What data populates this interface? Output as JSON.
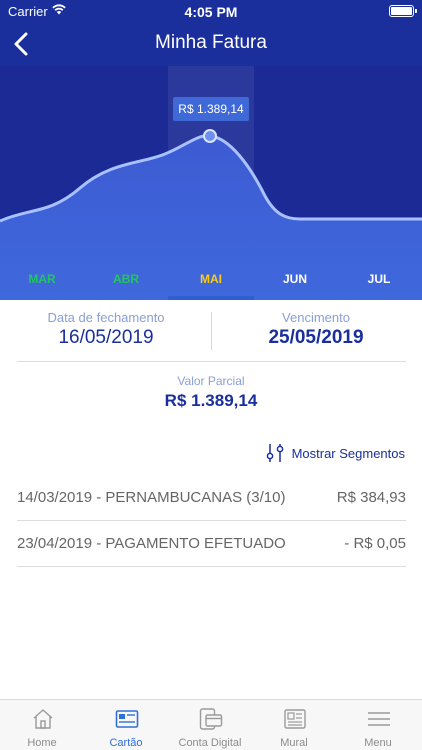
{
  "status_bar": {
    "carrier": "Carrier",
    "time": "4:05 PM"
  },
  "nav": {
    "title": "Minha Fatura"
  },
  "chart_data": {
    "type": "area",
    "categories": [
      "MAR",
      "ABR",
      "MAI",
      "JUN",
      "JUL"
    ],
    "selected_category": "MAI",
    "tooltip": "R$ 1.389,14",
    "category_colors": {
      "MAR": "#22c55e",
      "ABR": "#22c55e",
      "MAI": "#facc15",
      "JUN": "#ffffff",
      "JUL": "#ffffff"
    }
  },
  "dates": {
    "closing_label": "Data de fechamento",
    "closing_value": "16/05/2019",
    "due_label": "Vencimento",
    "due_value": "25/05/2019"
  },
  "partial": {
    "label": "Valor Parcial",
    "value": "R$ 1.389,14"
  },
  "segments_label": "Mostrar Segmentos",
  "transactions": [
    {
      "description": "14/03/2019 - PERNAMBUCANAS (3/10)",
      "amount": "R$ 384,93"
    },
    {
      "description": "23/04/2019 - PAGAMENTO EFETUADO",
      "amount": "- R$ 0,05"
    }
  ],
  "tabs": [
    {
      "label": "Home",
      "icon": "home-icon",
      "active": false
    },
    {
      "label": "Cartão",
      "icon": "card-icon",
      "active": true
    },
    {
      "label": "Conta Digital",
      "icon": "digital-account-icon",
      "active": false
    },
    {
      "label": "Mural",
      "icon": "mural-icon",
      "active": false
    },
    {
      "label": "Menu",
      "icon": "menu-icon",
      "active": false
    }
  ],
  "colors": {
    "primary": "#1a2f9c",
    "accent": "#2f6fd6"
  }
}
